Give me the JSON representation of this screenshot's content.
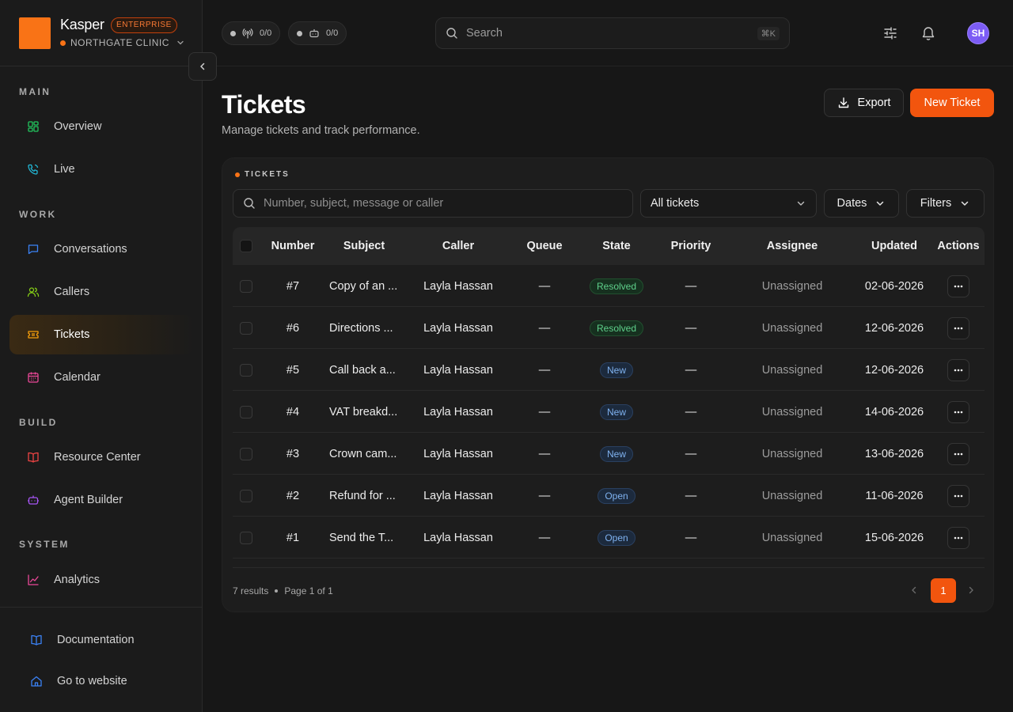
{
  "brand": {
    "name": "Kasper",
    "badge": "ENTERPRISE",
    "org": "NORTHGATE CLINIC"
  },
  "sidebar": {
    "sections": [
      {
        "label": "MAIN",
        "items": [
          {
            "label": "Overview",
            "icon": "grid-icon",
            "color": "#22c55e"
          },
          {
            "label": "Live",
            "icon": "phone-icon",
            "color": "#22b8d6"
          }
        ]
      },
      {
        "label": "WORK",
        "items": [
          {
            "label": "Conversations",
            "icon": "chat-icon",
            "color": "#3b82f6"
          },
          {
            "label": "Callers",
            "icon": "users-icon",
            "color": "#84cc16"
          },
          {
            "label": "Tickets",
            "icon": "ticket-icon",
            "color": "#f59e0b",
            "active": true
          },
          {
            "label": "Calendar",
            "icon": "calendar-icon",
            "color": "#ec4899"
          }
        ]
      },
      {
        "label": "BUILD",
        "items": [
          {
            "label": "Resource Center",
            "icon": "book-icon",
            "color": "#ef4444"
          },
          {
            "label": "Agent Builder",
            "icon": "bot-icon",
            "color": "#a855f7"
          }
        ]
      },
      {
        "label": "SYSTEM",
        "items": [
          {
            "label": "Analytics",
            "icon": "chart-icon",
            "color": "#ec4899"
          }
        ]
      }
    ],
    "footer": [
      {
        "label": "Documentation",
        "icon": "book-open-icon",
        "color": "#3b82f6"
      },
      {
        "label": "Go to website",
        "icon": "home-icon",
        "color": "#3b82f6"
      }
    ]
  },
  "topbar": {
    "pills": [
      {
        "icon": "antenna-icon",
        "value": "0/0"
      },
      {
        "icon": "robot-icon",
        "value": "0/0"
      }
    ],
    "search_placeholder": "Search",
    "shortcut": "⌘K",
    "avatar": "SH"
  },
  "page": {
    "title": "Tickets",
    "subtitle": "Manage tickets and track performance.",
    "export_label": "Export",
    "new_label": "New Ticket"
  },
  "card": {
    "label": "TICKETS",
    "search_placeholder": "Number, subject, message or caller",
    "filter_all": "All tickets",
    "filter_dates": "Dates",
    "filter_filters": "Filters",
    "columns": [
      "Number",
      "Subject",
      "Caller",
      "Queue",
      "State",
      "Priority",
      "Assignee",
      "Updated",
      "Actions"
    ],
    "rows": [
      {
        "number": "#7",
        "subject": "Copy of an ...",
        "caller": "Layla Hassan",
        "queue": "—",
        "state": "Resolved",
        "priority": "—",
        "assignee": "Unassigned",
        "updated": "02-06-2026"
      },
      {
        "number": "#6",
        "subject": "Directions ...",
        "caller": "Layla Hassan",
        "queue": "—",
        "state": "Resolved",
        "priority": "—",
        "assignee": "Unassigned",
        "updated": "12-06-2026"
      },
      {
        "number": "#5",
        "subject": "Call back a...",
        "caller": "Layla Hassan",
        "queue": "—",
        "state": "New",
        "priority": "—",
        "assignee": "Unassigned",
        "updated": "12-06-2026"
      },
      {
        "number": "#4",
        "subject": "VAT breakd...",
        "caller": "Layla Hassan",
        "queue": "—",
        "state": "New",
        "priority": "—",
        "assignee": "Unassigned",
        "updated": "14-06-2026"
      },
      {
        "number": "#3",
        "subject": "Crown cam...",
        "caller": "Layla Hassan",
        "queue": "—",
        "state": "New",
        "priority": "—",
        "assignee": "Unassigned",
        "updated": "13-06-2026"
      },
      {
        "number": "#2",
        "subject": "Refund for ...",
        "caller": "Layla Hassan",
        "queue": "—",
        "state": "Open",
        "priority": "—",
        "assignee": "Unassigned",
        "updated": "11-06-2026"
      },
      {
        "number": "#1",
        "subject": "Send the T...",
        "caller": "Layla Hassan",
        "queue": "—",
        "state": "Open",
        "priority": "—",
        "assignee": "Unassigned",
        "updated": "15-06-2026"
      }
    ],
    "results": "7 results",
    "page_info": "Page 1 of 1",
    "current_page": "1"
  }
}
